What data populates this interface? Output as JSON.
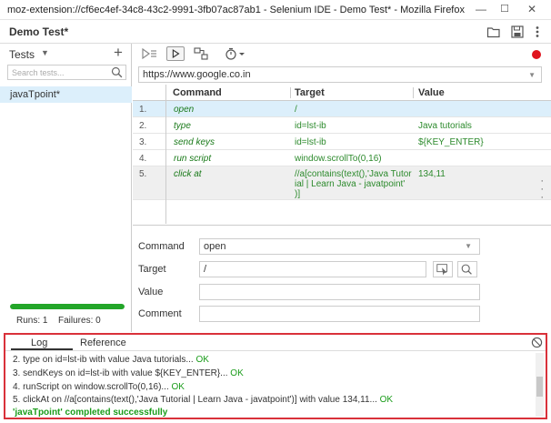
{
  "window": {
    "title": "moz-extension://cf6ec4ef-34c8-43c2-9991-3fb07ac87ab1 - Selenium IDE - Demo Test* - Mozilla Firefox",
    "minimize": "—",
    "maximize": "☐",
    "close": "✕"
  },
  "header": {
    "project_title": "Demo Test*"
  },
  "tests": {
    "title": "Tests",
    "search_placeholder": "Search tests...",
    "items": [
      "javaTpoint*"
    ],
    "progress": 1.0,
    "progress_color": "#23a629",
    "runs_label": "Runs: 1",
    "failures_label": "Failures: 0"
  },
  "toolbar": {
    "url": "https://www.google.co.in",
    "record_color": "#e0141e"
  },
  "table": {
    "headers": {
      "command": "Command",
      "target": "Target",
      "value": "Value"
    },
    "rows": [
      {
        "index": "1.",
        "command": "open",
        "target": "/",
        "value": ""
      },
      {
        "index": "2.",
        "command": "type",
        "target": "id=lst-ib",
        "value": "Java tutorials"
      },
      {
        "index": "3.",
        "command": "send keys",
        "target": "id=lst-ib",
        "value": "${KEY_ENTER}"
      },
      {
        "index": "4.",
        "command": "run script",
        "target": "window.scrollTo(0,16)",
        "value": ""
      },
      {
        "index": "5.",
        "command": "click at",
        "target_lines": [
          "//a[contains(text(),'Java Tutor",
          "ial | Learn Java - javatpoint'",
          ")]"
        ],
        "value": "134,11"
      }
    ]
  },
  "editor": {
    "command_label": "Command",
    "command_value": "open",
    "target_label": "Target",
    "target_value": "/",
    "value_label": "Value",
    "value_value": "",
    "comment_label": "Comment",
    "comment_value": ""
  },
  "log": {
    "tab_log": "Log",
    "tab_reference": "Reference",
    "lines": [
      {
        "text": "2.   type on id=lst-ib with value Java tutorials...",
        "ok": "OK"
      },
      {
        "text": "3.   sendKeys on id=lst-ib with value ${KEY_ENTER}...",
        "ok": "OK"
      },
      {
        "text": "4.   runScript on window.scrollTo(0,16)...",
        "ok": "OK"
      },
      {
        "text": "5.   clickAt on //a[contains(text(),'Java Tutorial | Learn Java - javatpoint')] with value 134,11...",
        "ok": "OK"
      }
    ],
    "success_message": "'javaTpoint' completed successfully",
    "border_color": "#d9313a"
  }
}
